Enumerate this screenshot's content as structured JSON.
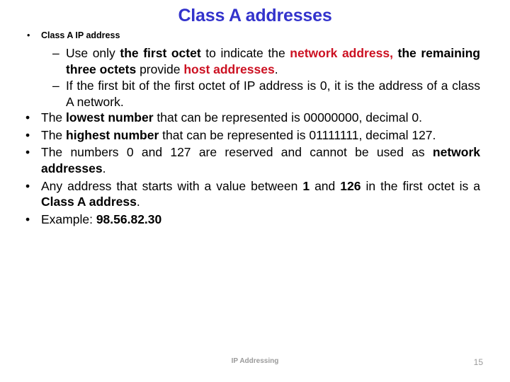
{
  "slide": {
    "title": "Class A addresses",
    "title_color": "#3333CC",
    "accent_red": "#CC1122",
    "bullet_glyph": "•",
    "dash_glyph": "–"
  },
  "content": {
    "item0": {
      "text": "Class A IP address"
    },
    "sub1": {
      "part1": "Use only ",
      "part2_bold": "the first octet",
      "part3": " to indicate the ",
      "part4_red": "network address",
      "part5_red_comma": ",",
      "part6_bold": " the remaining three octets",
      "part7": " provide  ",
      "part8_red": "host addresses",
      "part9": "."
    },
    "sub2": {
      "text": "If the first bit of the first octet of IP address is 0, it is the address of a class A network."
    },
    "item1": {
      "part1": "The ",
      "part2_bold": "lowest number",
      "part3": " that can be represented is 00000000, decimal 0."
    },
    "item2": {
      "part1": "The ",
      "part2_bold": "highest number",
      "part3": " that can be represented is 01111111, decimal 127."
    },
    "item3": {
      "part1": "The numbers 0 and 127 are reserved and cannot be used as ",
      "part2_bold": "network addresses",
      "part3": "."
    },
    "item4": {
      "part1": "Any address that starts with a value between ",
      "part2_bold": "1",
      "part3": " and ",
      "part4_bold": "126",
      "part5": " in the first octet is a ",
      "part6_bold": "Class A address",
      "part7": "."
    },
    "item5": {
      "part1": "Example: ",
      "part2_bold": "98.56.82.30"
    }
  },
  "footer": {
    "label": "IP Addressing",
    "slide_number": "15",
    "color": "#9a9a9a"
  }
}
